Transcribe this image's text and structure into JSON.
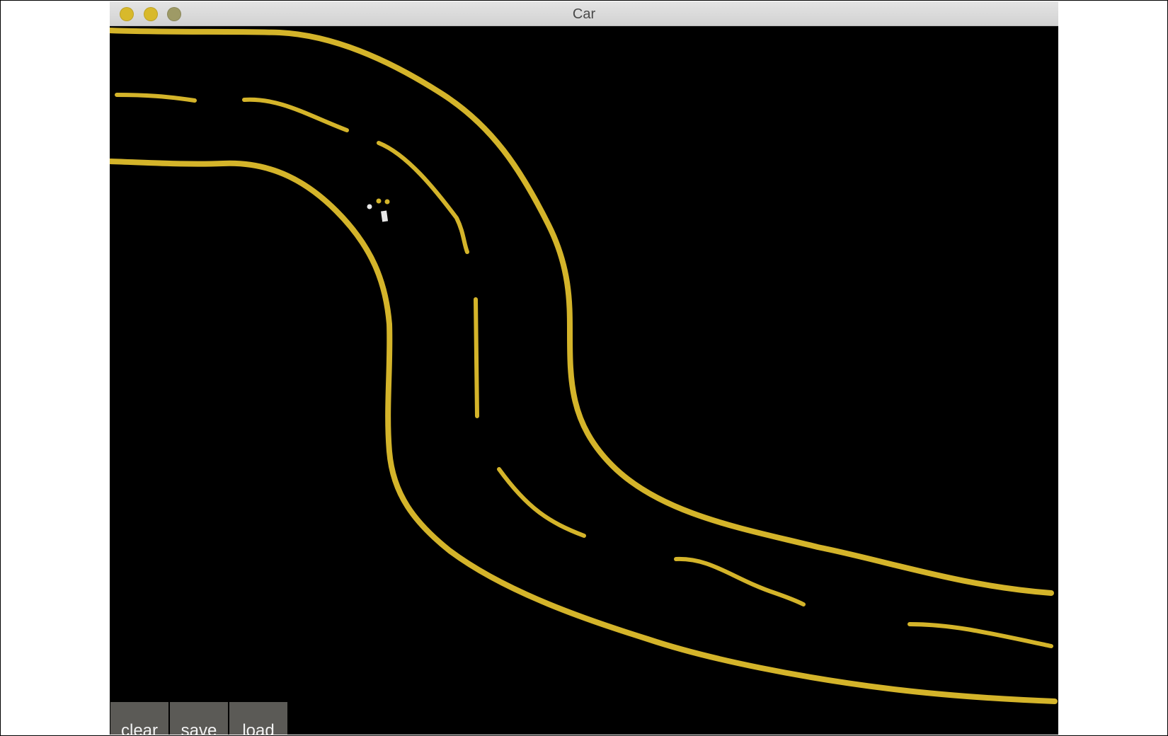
{
  "window": {
    "title": "Car"
  },
  "toolbar": {
    "clear_label": "clear",
    "save_label": "save",
    "load_label": "load"
  },
  "canvas": {
    "background_color": "#000000",
    "road_color": "#d4b42a",
    "car_color": "#e8e8e8",
    "sensor_colors": [
      "#e8e8e8",
      "#d4b42a",
      "#d4b42a"
    ]
  }
}
